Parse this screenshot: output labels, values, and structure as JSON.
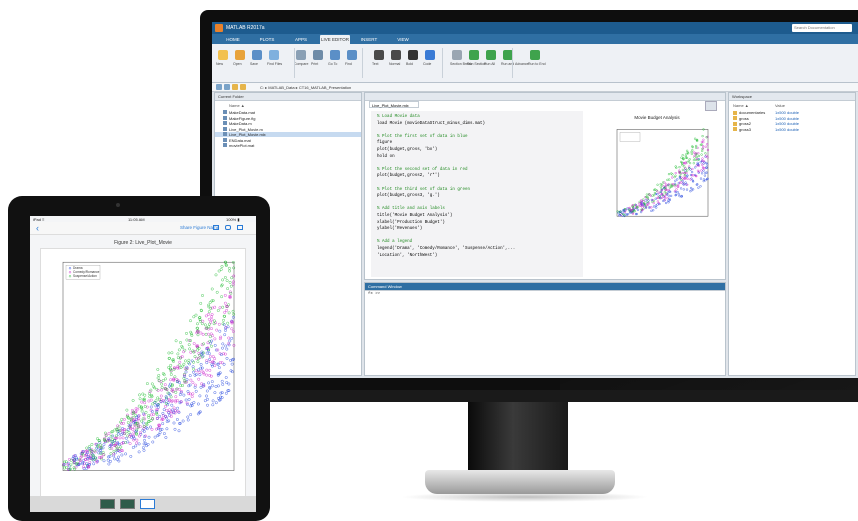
{
  "matlab": {
    "window_title": "MATLAB R2017a",
    "search_placeholder": "Search Documentation",
    "ribbon_tabs": [
      "HOME",
      "PLOTS",
      "APPS",
      "LIVE EDITOR",
      "INSERT",
      "VIEW"
    ],
    "active_tab_index": 3,
    "ribbon_buttons": [
      "New",
      "Open",
      "Save",
      "Find Files",
      "Compare",
      "Print",
      "Go To",
      "Find",
      "Text",
      "Normal",
      "Bold",
      "Code",
      "Section Break",
      "Run Section",
      "Run All",
      "Run and Advance",
      "Run to End"
    ],
    "path": "C: ▸ MATLAB_Data ▸ CT16_MATLAB_Presentation",
    "current_folder": {
      "title": "Current Folder",
      "column_name": "Name ▲",
      "files": [
        "MakeData.mat",
        "MakeFigure.fig",
        "MakeData.m",
        "Live_Plot_Movie.m",
        "Live_Plot_Movie.mlx",
        "ENData.mat",
        "moviePlot.mat"
      ],
      "selected_index": 4
    },
    "editor": {
      "tab_title": "Live_Plot_Movie.mlx",
      "code_lines": [
        [
          "c",
          "% Load Movie data"
        ],
        [
          "m",
          "load Movie (movieDataStruct_minus_dims.mat)"
        ],
        [
          "b",
          ""
        ],
        [
          "c",
          "% Plot the first set of data in blue"
        ],
        [
          "m",
          "figure"
        ],
        [
          "m",
          "plot(budget,gross, 'bo')"
        ],
        [
          "m",
          "hold on"
        ],
        [
          "b",
          ""
        ],
        [
          "c",
          "% Plot the second set of data in red"
        ],
        [
          "m",
          "plot(budget,gross2, 'r*')"
        ],
        [
          "b",
          ""
        ],
        [
          "c",
          "% Plot the third set of data in green"
        ],
        [
          "m",
          "plot(budget,gross3, 'g.')"
        ],
        [
          "b",
          ""
        ],
        [
          "c",
          "% Add title and axis labels"
        ],
        [
          "m",
          "title('Movie Budget Analysis')"
        ],
        [
          "m",
          "xlabel('Production Budget')"
        ],
        [
          "m",
          "ylabel('Revenues')"
        ],
        [
          "b",
          ""
        ],
        [
          "c",
          "% Add a legend"
        ],
        [
          "m",
          "legend('Drama', 'Comedy/Romance', 'Suspense/Action',..."
        ],
        [
          "m",
          "    'Location', 'NorthWest')"
        ]
      ]
    },
    "preview_chart_title": "Movie Budget Analysis",
    "command_window": {
      "title": "Command Window",
      "prompt": "fx >> "
    },
    "workspace": {
      "title": "Workspace",
      "headers": [
        "Name ▲",
        "Value"
      ],
      "rows": [
        [
          "documentaries",
          "1x500 double"
        ],
        [
          "gross",
          "1x500 double"
        ],
        [
          "gross2",
          "1x500 double"
        ],
        [
          "gross3",
          "1x500 double"
        ]
      ]
    }
  },
  "tablet": {
    "status_carrier": "iPad ≡",
    "status_time": "11:05 AM",
    "status_battery": "100% ▮",
    "back_label": "‹",
    "share_label": "Share Figure Name",
    "figure_title": "Figure 2: Live_Plot_Movie",
    "legend": [
      "Drama",
      "Comedy/Romance",
      "Suspense/Action"
    ]
  },
  "colors": {
    "series": [
      "#2244dd",
      "#cc22cc",
      "#22bb33"
    ],
    "accent": "#2f6fa3"
  }
}
